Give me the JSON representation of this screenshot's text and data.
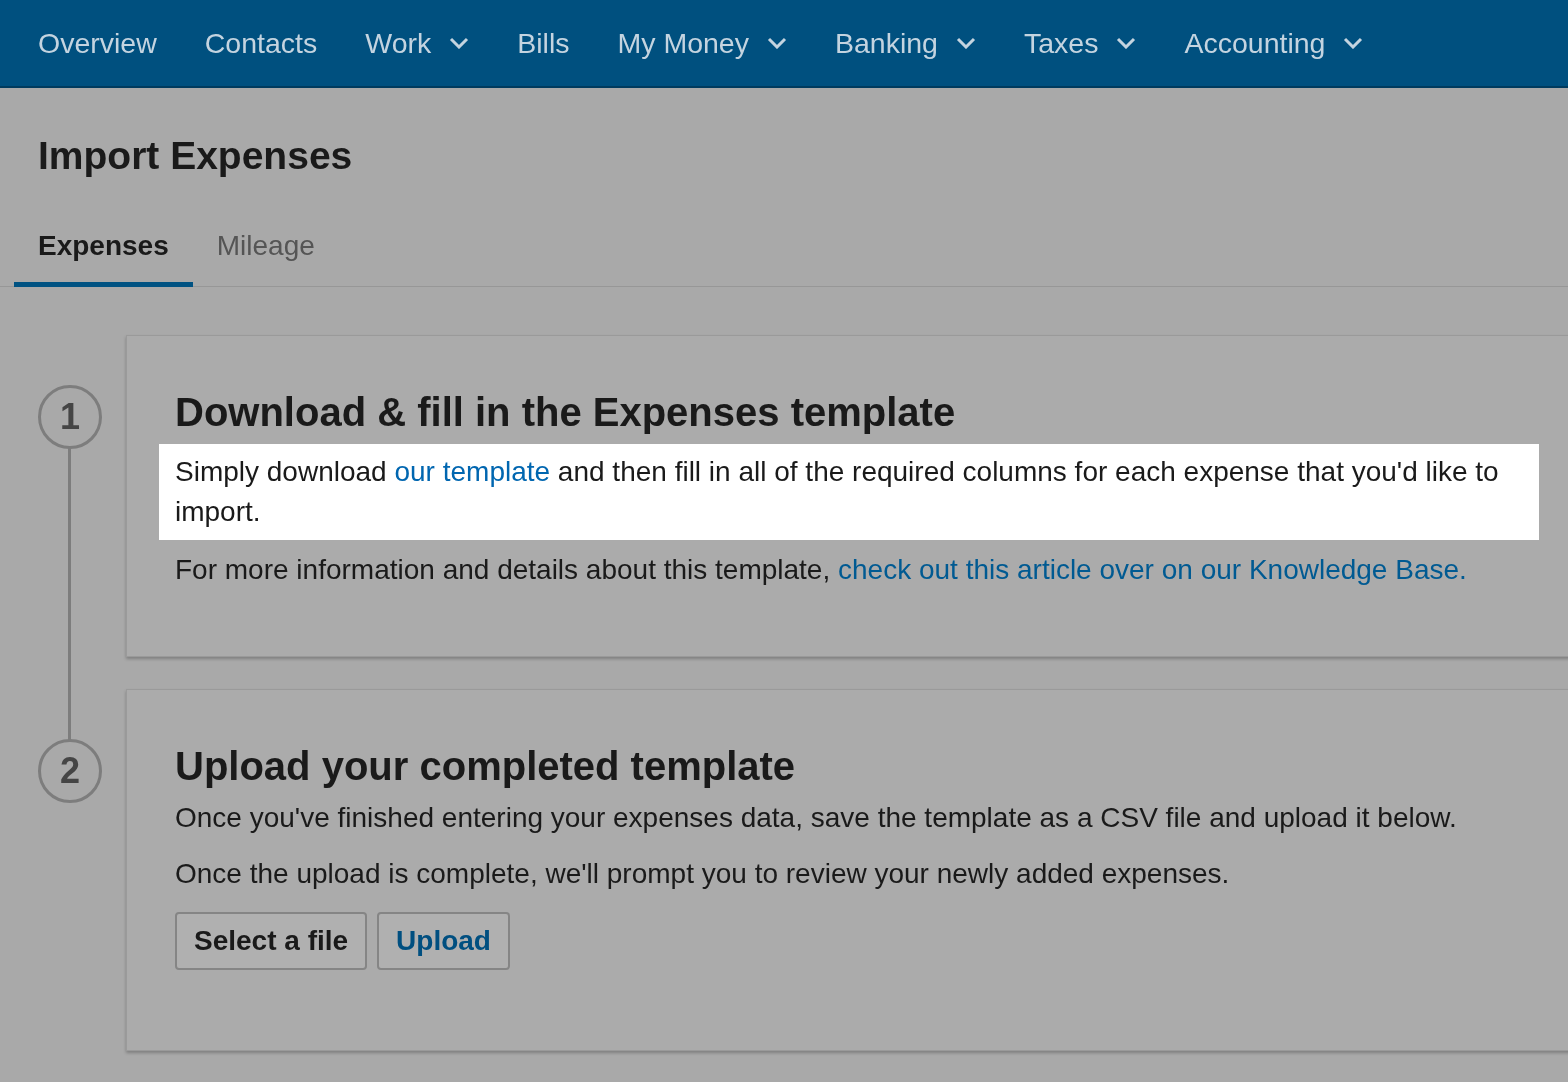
{
  "nav": [
    {
      "label": "Overview",
      "dropdown": false
    },
    {
      "label": "Contacts",
      "dropdown": false
    },
    {
      "label": "Work",
      "dropdown": true
    },
    {
      "label": "Bills",
      "dropdown": false
    },
    {
      "label": "My Money",
      "dropdown": true
    },
    {
      "label": "Banking",
      "dropdown": true
    },
    {
      "label": "Taxes",
      "dropdown": true
    },
    {
      "label": "Accounting",
      "dropdown": true
    }
  ],
  "title": "Import Expenses",
  "tabs": [
    {
      "label": "Expenses",
      "selected": true
    },
    {
      "label": "Mileage",
      "selected": false
    }
  ],
  "steps": [
    {
      "number": "1",
      "heading": "Download & fill in the Expenses template",
      "paragraphs": [
        {
          "highlighted": true,
          "segments": [
            {
              "kind": "text",
              "text": "Simply download "
            },
            {
              "kind": "link",
              "text": "our template"
            },
            {
              "kind": "text",
              "text": " and then fill in all of the required columns for each expense that you'd like to import."
            }
          ]
        },
        {
          "highlighted": false,
          "segments": [
            {
              "kind": "text",
              "text": "For more information and details about this template, "
            },
            {
              "kind": "link",
              "text": "check out this article over on our Knowledge Base."
            }
          ]
        }
      ]
    },
    {
      "number": "2",
      "heading": "Upload your completed template",
      "paragraphs": [
        {
          "highlighted": false,
          "segments": [
            {
              "kind": "text",
              "text": "Once you've finished entering your expenses data, save the template as a CSV file and upload it below."
            }
          ]
        },
        {
          "highlighted": false,
          "segments": [
            {
              "kind": "text",
              "text": "Once the upload is complete, we'll prompt you to review your newly added expenses."
            }
          ]
        }
      ],
      "buttons": [
        {
          "label": "Select a file",
          "kind": "default"
        },
        {
          "label": "Upload",
          "kind": "primary"
        }
      ]
    }
  ]
}
